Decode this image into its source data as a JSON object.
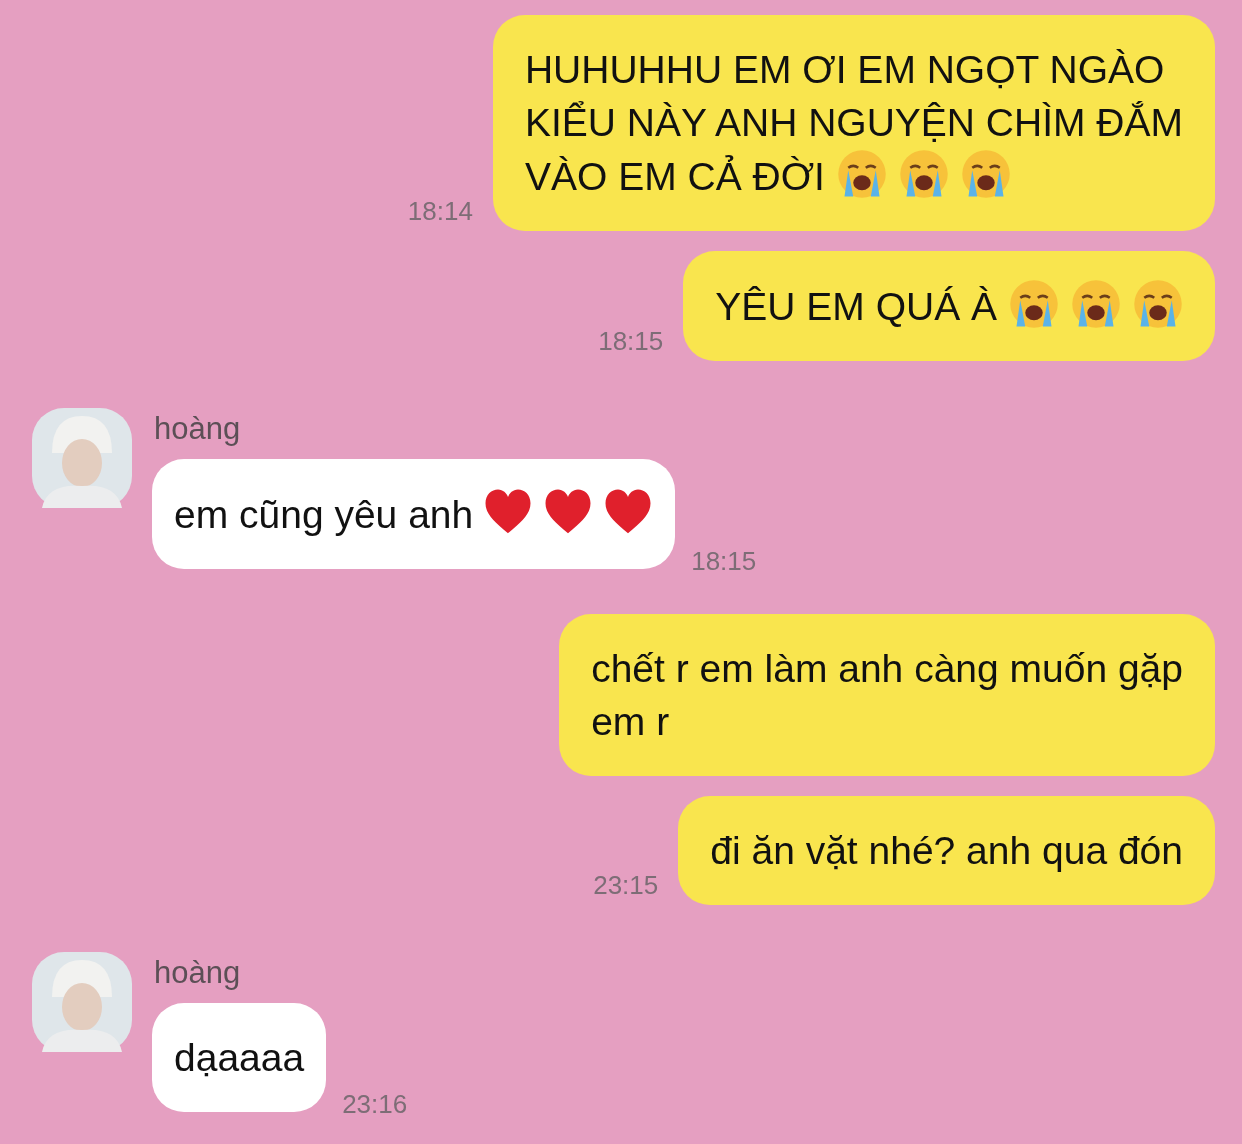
{
  "messages": [
    {
      "kind": "outgoing",
      "text": "HUHUHHU EM ƠI EM NGỌT NGÀO\nKIỂU NÀY ANH NGUYỆN CHÌM ĐẮM\nVÀO EM CẢ ĐỜI",
      "emoji": [
        {
          "kind": "crying"
        },
        {
          "kind": "crying"
        },
        {
          "kind": "crying"
        }
      ],
      "time": "18:14"
    },
    {
      "kind": "outgoing",
      "text": "YÊU EM QUÁ À",
      "emoji": [
        {
          "kind": "crying"
        },
        {
          "kind": "crying"
        },
        {
          "kind": "crying"
        }
      ],
      "time": "18:15"
    },
    {
      "kind": "incoming",
      "sender": "hoàng",
      "text": "em cũng yêu anh",
      "emoji": [
        {
          "kind": "heart"
        },
        {
          "kind": "heart"
        },
        {
          "kind": "heart"
        }
      ],
      "time": "18:15"
    },
    {
      "kind": "outgoing",
      "text": "chết r em làm anh càng muốn gặp\nem r"
    },
    {
      "kind": "outgoing",
      "text": "đi ăn vặt nhé? anh qua đón",
      "time": "23:15"
    },
    {
      "kind": "incoming",
      "sender": "hoàng",
      "text": "dạaaaa",
      "time": "23:16"
    }
  ]
}
